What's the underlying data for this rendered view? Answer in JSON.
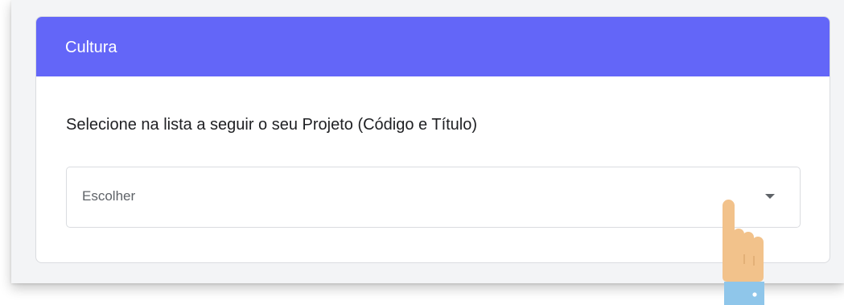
{
  "form": {
    "section_title": "Cultura",
    "question": "Selecione na lista a seguir o seu Projeto (Código e Título)",
    "dropdown": {
      "selected": "Escolher",
      "icon": "caret-down-icon"
    }
  },
  "overlay": {
    "icon": "pointing-hand-icon"
  },
  "colors": {
    "header": "#6366f8",
    "hand_skin": "#f2c28b",
    "cuff": "#8fc6ea"
  }
}
